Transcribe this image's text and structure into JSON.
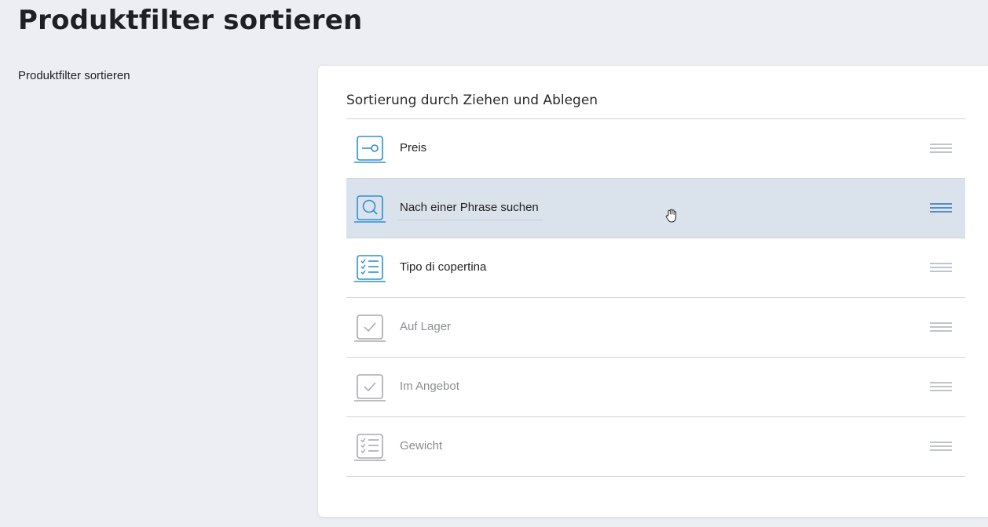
{
  "page": {
    "title": "Produktfilter sortieren",
    "side_label": "Produktfilter sortieren"
  },
  "card": {
    "title": "Sortierung durch Ziehen und Ablegen",
    "items": [
      {
        "label": "Preis",
        "icon": "slider-icon",
        "state": "enabled"
      },
      {
        "label": "Nach einer Phrase suchen",
        "icon": "search-icon",
        "state": "dragging"
      },
      {
        "label": "Tipo di copertina",
        "icon": "checklist-icon",
        "state": "enabled"
      },
      {
        "label": "Auf Lager",
        "icon": "checkbox-icon",
        "state": "disabled"
      },
      {
        "label": "Im Angebot",
        "icon": "checkbox-icon",
        "state": "disabled"
      },
      {
        "label": "Gewicht",
        "icon": "checklist-icon",
        "state": "disabled"
      }
    ]
  },
  "colors": {
    "background": "#edeef3",
    "accent": "#2b8fd6",
    "active_row": "#dae2ec",
    "disabled": "#a6a9ae"
  },
  "cursor": "grab-hand-icon"
}
